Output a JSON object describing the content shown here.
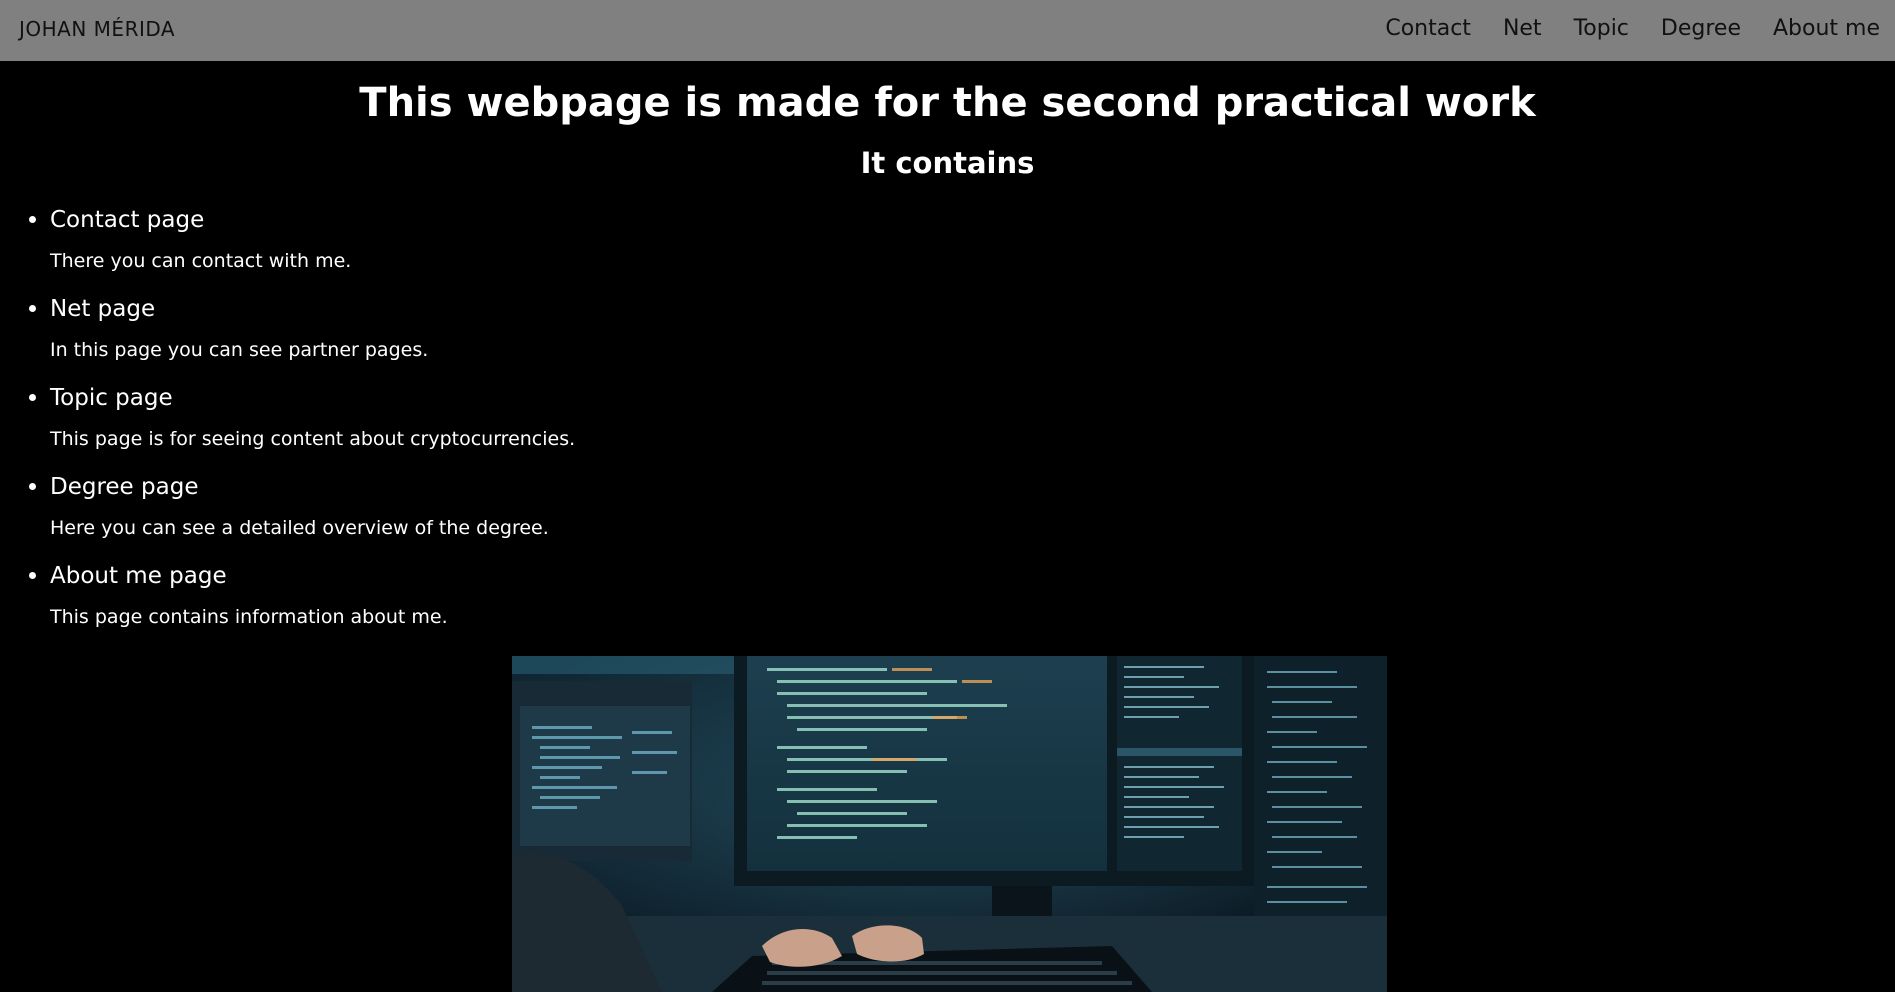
{
  "navbar": {
    "brand": "JOHAN MÉRIDA",
    "links": [
      "Contact",
      "Net",
      "Topic",
      "Degree",
      "About me"
    ]
  },
  "main": {
    "title": "This webpage is made for the second practical work",
    "subtitle": "It contains",
    "items": [
      {
        "title": "Contact page",
        "desc": "There you can contact with me."
      },
      {
        "title": "Net page",
        "desc": "In this page you can see partner pages."
      },
      {
        "title": "Topic page",
        "desc": "This page is for seeing content about cryptocurrencies."
      },
      {
        "title": "Degree page",
        "desc": "Here you can see a detailed overview of the degree."
      },
      {
        "title": "About me page",
        "desc": "This page contains information about me."
      }
    ]
  },
  "colors": {
    "navbar_bg": "#808080",
    "page_bg": "#000000",
    "text": "#ffffff",
    "nav_text": "#111111"
  }
}
